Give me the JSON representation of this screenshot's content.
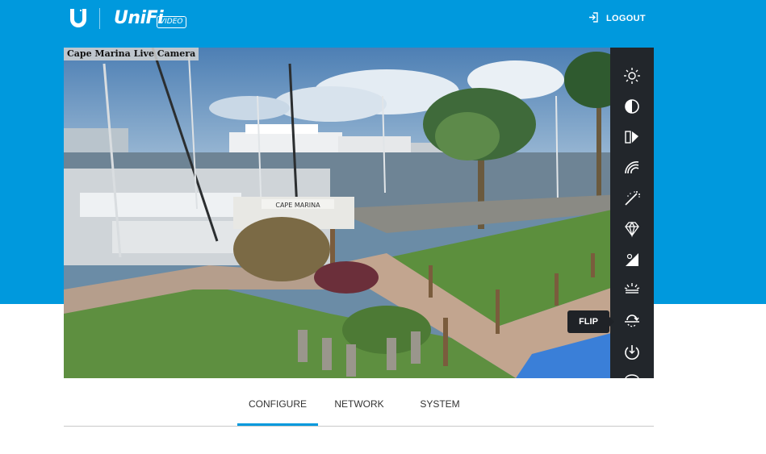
{
  "header": {
    "brand_text": "UniFi",
    "brand_badge": "VIDEO",
    "logout_label": "LOGOUT",
    "icons": [
      "ubiquiti-logo-icon",
      "logout-icon"
    ]
  },
  "camera": {
    "title": "Cape Marina Live Camera",
    "sign_text": "CAPE MARINA"
  },
  "toolbar": {
    "items": [
      {
        "name": "brightness",
        "icon": "brightness-icon"
      },
      {
        "name": "contrast",
        "icon": "contrast-icon"
      },
      {
        "name": "saturation",
        "icon": "saturation-icon"
      },
      {
        "name": "sharpness",
        "icon": "sharpness-icon"
      },
      {
        "name": "denoise",
        "icon": "denoise-icon"
      },
      {
        "name": "quality",
        "icon": "diamond-icon"
      },
      {
        "name": "day-night",
        "icon": "day-night-icon"
      },
      {
        "name": "infrared",
        "icon": "infrared-icon"
      },
      {
        "name": "flip",
        "icon": "flip-icon"
      },
      {
        "name": "rotate",
        "icon": "rotate-icon"
      }
    ],
    "tooltip": "FLIP"
  },
  "tabs": [
    {
      "label": "CONFIGURE",
      "active": true
    },
    {
      "label": "NETWORK",
      "active": false
    },
    {
      "label": "SYSTEM",
      "active": false
    }
  ],
  "colors": {
    "brand_blue": "#0099dd",
    "sidebar_bg": "#22262b"
  }
}
